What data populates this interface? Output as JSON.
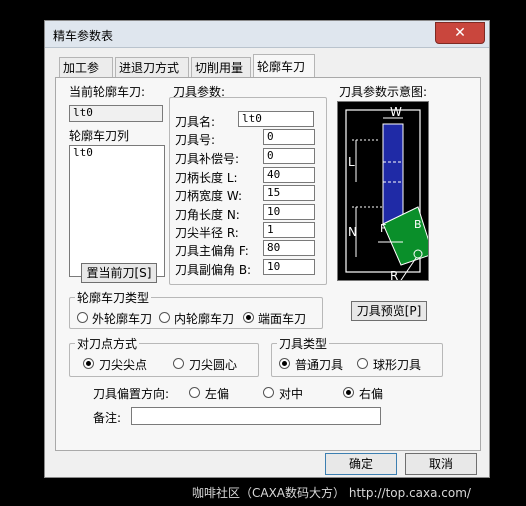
{
  "dialog": {
    "title": "精车参数表",
    "close_glyph": "✕"
  },
  "tabs": [
    "加工参数",
    "进退刀方式",
    "切削用量",
    "轮廓车刀"
  ],
  "current_tool": {
    "label": "当前轮廓车刀:",
    "value": "lt0"
  },
  "tool_list": {
    "label": "轮廓车刀列",
    "items": [
      "lt0"
    ]
  },
  "set_current_button": "置当前刀[S]",
  "tool_params": {
    "title": "刀具参数:",
    "rows": [
      {
        "label": "刀具名:",
        "value": "lt0"
      },
      {
        "label": "刀具号:",
        "value": "0"
      },
      {
        "label": "刀具补偿号:",
        "value": "0"
      },
      {
        "label": "刀柄长度 L:",
        "value": "40"
      },
      {
        "label": "刀柄宽度 W:",
        "value": "15"
      },
      {
        "label": "刀角长度 N:",
        "value": "10"
      },
      {
        "label": "刀尖半径 R:",
        "value": "1"
      },
      {
        "label": "刀具主偏角 F:",
        "value": "80"
      },
      {
        "label": "刀具副偏角 B:",
        "value": "10"
      }
    ]
  },
  "diagram": {
    "title": "刀具参数示意图:",
    "labels": {
      "W": "W",
      "L": "L",
      "N": "N",
      "F": "F",
      "B": "B",
      "R": "R"
    }
  },
  "preview_button": "刀具预览[P]",
  "tool_type_group": {
    "title": "轮廓车刀类型",
    "options": [
      "外轮廓车刀",
      "内轮廓车刀",
      "端面车刀"
    ],
    "selected": 2
  },
  "tool_point_group": {
    "title": "对刀点方式",
    "options": [
      "刀尖尖点",
      "刀尖圆心"
    ],
    "selected": 0
  },
  "cutter_type_group": {
    "title": "刀具类型",
    "options": [
      "普通刀具",
      "球形刀具"
    ],
    "selected": 0
  },
  "offset_direction": {
    "label": "刀具偏置方向:",
    "options": [
      "左偏",
      "对中",
      "右偏"
    ],
    "selected": 2
  },
  "remark": {
    "label": "备注:",
    "value": ""
  },
  "ok_button": "确定",
  "cancel_button": "取消",
  "watermark": "咖啡社区（CAXA数码大方） http://top.caxa.com/"
}
